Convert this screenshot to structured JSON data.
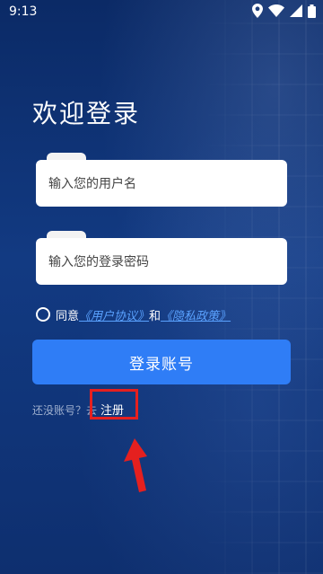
{
  "status_bar": {
    "time": "9:13",
    "icons": [
      "location-icon",
      "wifi-icon",
      "signal-icon",
      "battery-icon"
    ]
  },
  "login": {
    "title": "欢迎登录",
    "username": {
      "placeholder": "输入您的用户名",
      "value": ""
    },
    "password": {
      "placeholder": "输入您的登录密码",
      "value": ""
    },
    "agreement": {
      "prefix": "同意",
      "user_agreement": "《用户协议》",
      "and": "和",
      "privacy_policy": "《隐私政策》",
      "checked": false
    },
    "login_button": "登录账号",
    "register_hint": "还没账号？去",
    "register_link": "注册"
  },
  "annotation": {
    "highlight_color": "#e5201f"
  },
  "colors": {
    "primary_button": "#2f7df6",
    "link": "#5aa2ff",
    "background": "#0d2a63"
  }
}
